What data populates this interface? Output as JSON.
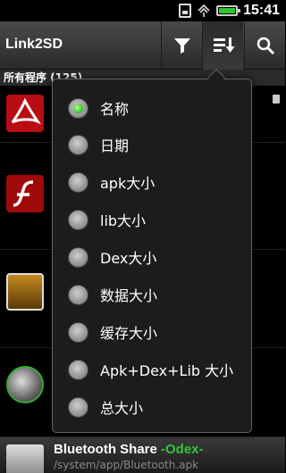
{
  "status_bar": {
    "time": "15:41",
    "icons": [
      "sim-card-icon",
      "signal-icon",
      "battery-icon"
    ]
  },
  "action_bar": {
    "title": "Link2SD",
    "buttons": [
      "filter-icon",
      "sort-icon",
      "search-icon"
    ]
  },
  "list_header": {
    "label": "所有程序 (125)"
  },
  "apps": [
    {
      "icon": "acrobat-icon"
    },
    {
      "icon": "flash-icon"
    },
    {
      "icon": "gallery-icon"
    },
    {
      "icon": "music-player-icon"
    }
  ],
  "last_item": {
    "name": "Bluetooth Share",
    "tag": "-Odex-",
    "path": "/system/app/Bluetooth.apk"
  },
  "sort_menu": {
    "selected": 0,
    "items": [
      "名称",
      "日期",
      "apk大小",
      "lib大小",
      "Dex大小",
      "数据大小",
      "缓存大小",
      "Apk+Dex+Lib 大小",
      "总大小"
    ]
  },
  "colors": {
    "radio_checked": "#2bc41d",
    "odex_tag": "#37c337",
    "acrobat_red": "#b80d12"
  }
}
